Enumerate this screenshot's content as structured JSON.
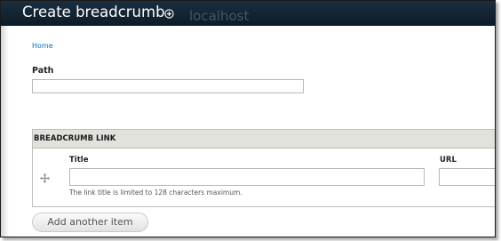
{
  "header": {
    "page_title": "Create breadcrumb",
    "site_title": "localhost",
    "background": "#12222f"
  },
  "icons": {
    "add_shortcut": "circled-plus-icon",
    "drag_handle": "move-cross-icon"
  },
  "breadcrumb": {
    "home_link": "Home",
    "link_color": "#0074bd"
  },
  "form": {
    "path_label": "Path",
    "path_value": "",
    "breadcrumb_table": {
      "heading": "BREADCRUMB LINK",
      "header_background": "#e1e2dc",
      "title_label": "Title",
      "title_value": "",
      "title_description": "The link title is limited to 128 characters maximum.",
      "url_label": "URL",
      "url_value": ""
    },
    "add_another_label": "Add another item"
  }
}
